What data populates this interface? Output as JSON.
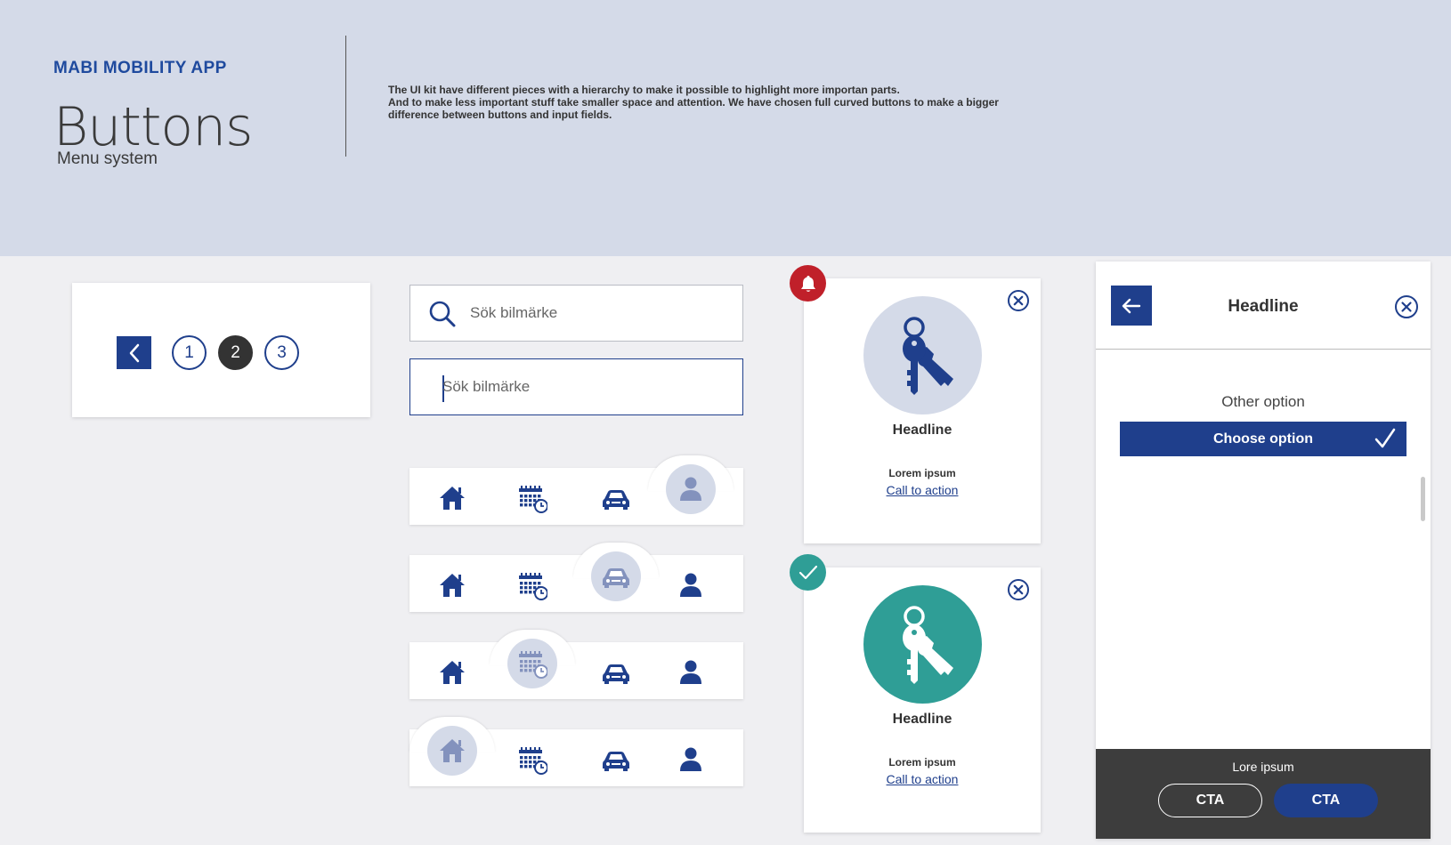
{
  "header": {
    "brand": "MABI MOBILITY APP",
    "title": "Buttons",
    "subtitle": "Menu system",
    "description_lines": [
      "The UI kit have different pieces with a hierarchy to make it possible to highlight more importan parts.",
      "And to make less important stuff take smaller space and attention. We have chosen full curved buttons to make a bigger",
      "difference between buttons and input fields."
    ]
  },
  "pagination": {
    "prev_icon": "chevron-left-icon",
    "pages": [
      "1",
      "2",
      "3"
    ],
    "active_page": "2"
  },
  "search": {
    "default": {
      "placeholder": "Sök bilmärke",
      "icon": "search-icon"
    },
    "focused": {
      "placeholder": "Sök bilmärke"
    }
  },
  "navbars": {
    "items": [
      "home-icon",
      "calendar-clock-icon",
      "car-icon",
      "user-icon"
    ],
    "active_indexes": [
      3,
      2,
      1,
      0
    ]
  },
  "cards": [
    {
      "headline": "Headline",
      "body": "Lorem ipsum",
      "link": "Call to action",
      "badge": "bell-icon",
      "badge_color": "#c0202a",
      "circle_color": "#d4dae8",
      "icon_color": "#1f3f8c"
    },
    {
      "headline": "Headline",
      "body": "Lorem ipsum",
      "link": "Call to action",
      "badge": "check-icon",
      "badge_color": "#2f9e96",
      "circle_color": "#2f9e96",
      "icon_color": "#ffffff"
    }
  ],
  "panel": {
    "title": "Headline",
    "other_option": "Other option",
    "choose_option": "Choose option",
    "footer_label": "Lore ipsum",
    "cta_outline": "CTA",
    "cta_filled": "CTA"
  },
  "colors": {
    "primary": "#1f3f8c",
    "header_bg": "#d4dae8",
    "page_bg": "#efeff2",
    "dark": "#3d3d3d",
    "alert": "#c0202a",
    "success": "#2f9e96"
  }
}
